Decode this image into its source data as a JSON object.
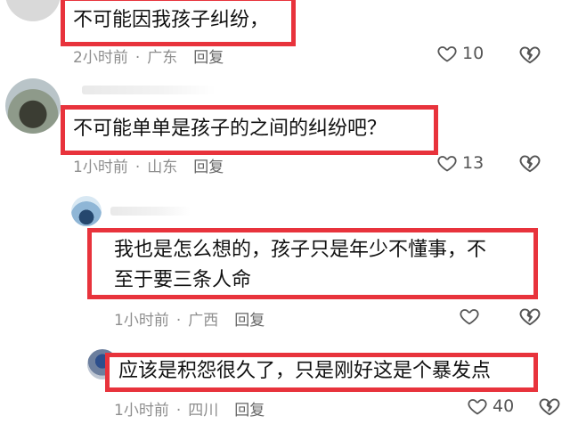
{
  "comments": [
    {
      "text_lines": [
        "不可能因我孩子纠纷，"
      ],
      "time": "2小时前",
      "location": "广东",
      "reply_label": "回复",
      "likes": "10"
    },
    {
      "text_lines": [
        "不可能单单是孩子的之间的纠纷吧？"
      ],
      "time": "1小时前",
      "location": "山东",
      "reply_label": "回复",
      "likes": "13"
    },
    {
      "text_lines": [
        "我也是怎么想的，孩子只是年少不懂事，不",
        "至于要三条人命"
      ],
      "time": "1小时前",
      "location": "广西",
      "reply_label": "回复",
      "likes": ""
    },
    {
      "text_lines": [
        "应该是积怨很久了，只是刚好这是个暴发点"
      ],
      "time": "1小时前",
      "location": "四川",
      "reply_label": "回复",
      "likes": "40"
    }
  ],
  "colors": {
    "highlight_border": "#e8333c",
    "meta_text": "#8e8e8e",
    "icon": "#555555"
  },
  "icons": {
    "like": "heart-outline-icon",
    "dislike": "broken-heart-icon"
  }
}
